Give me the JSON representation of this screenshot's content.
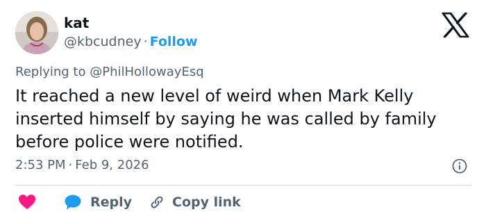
{
  "colors": {
    "accent": "#1d9bf0",
    "text_primary": "#0f1419",
    "text_secondary": "#536471",
    "like": "#f91880",
    "divider": "#cfd9de"
  },
  "author": {
    "avatar_icon": "profile-photo",
    "display_name": "kat",
    "handle": "@kbcudney",
    "separator": "·",
    "follow_label": "Follow"
  },
  "brand": {
    "logo_icon": "x-logo-icon"
  },
  "reply_context": {
    "prefix": "Replying to",
    "mention": "@PhilHollowayEsq"
  },
  "tweet": {
    "text": "It reached a new level of weird when Mark Kelly\ninserted himself by saying he was called by family\nbefore police were notified."
  },
  "meta": {
    "time": "2:53 PM",
    "separator": "·",
    "date": "Feb 9, 2026",
    "info_icon": "info-icon"
  },
  "actions": {
    "like_icon": "heart-icon",
    "reply_icon": "speech-bubble-icon",
    "reply_label": "Reply",
    "copy_icon": "link-icon",
    "copy_label": "Copy link"
  }
}
